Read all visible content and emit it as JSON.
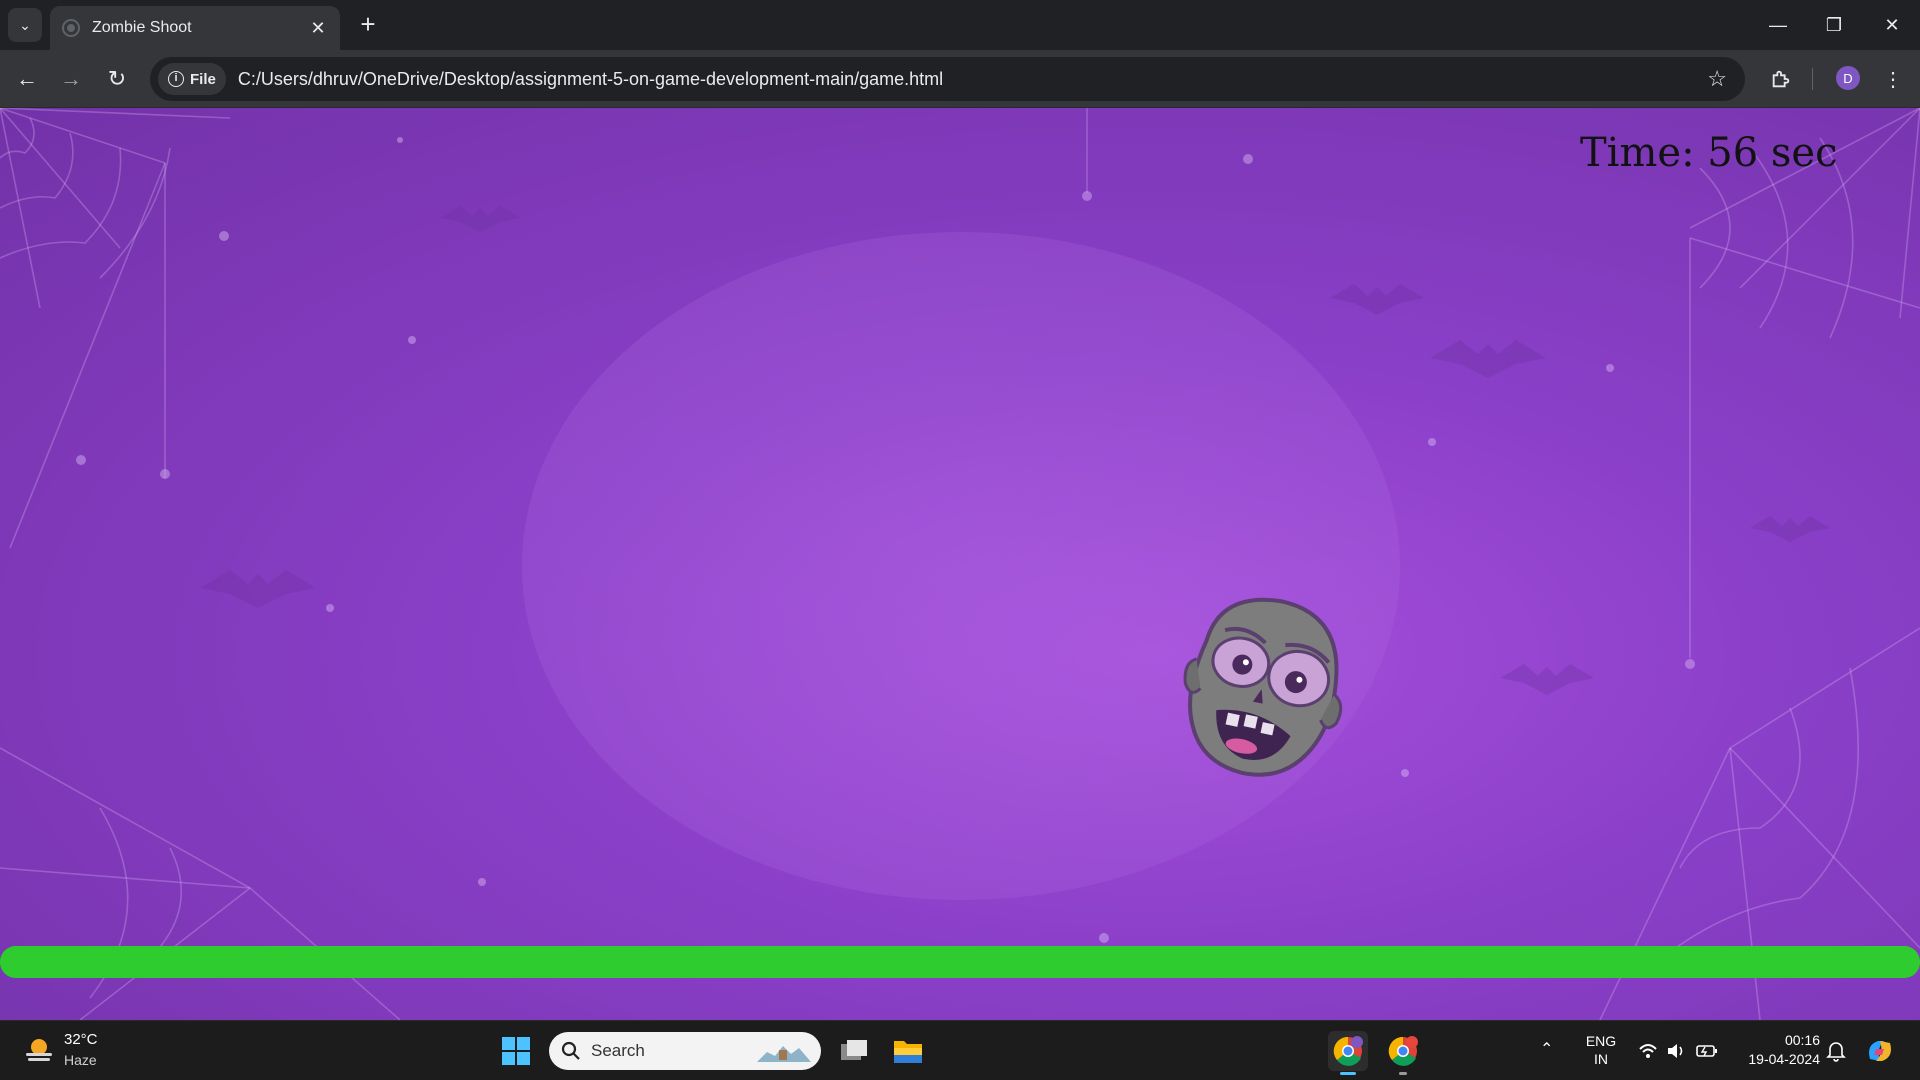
{
  "browser": {
    "tab_title": "Zombie Shoot",
    "url_chip": "File",
    "url": "C:/Users/dhruv/OneDrive/Desktop/assignment-5-on-game-development-main/game.html",
    "profile_initial": "D"
  },
  "game": {
    "timer_text": "Time: 56 sec",
    "health_fraction": 1.0,
    "colors": {
      "background": "#8a3fc8",
      "health": "#2ecc2e",
      "timer_text": "#121212"
    }
  },
  "taskbar": {
    "weather_temp": "32°C",
    "weather_condition": "Haze",
    "search_placeholder": "Search",
    "language_line1": "ENG",
    "language_line2": "IN",
    "time": "00:16",
    "date": "19-04-2024",
    "icons": [
      "weather-icon",
      "windows-start-icon",
      "search-icon",
      "task-view-icon",
      "file-explorer-icon",
      "chrome-icon",
      "chrome-icon",
      "chevron-up-icon",
      "wifi-icon",
      "volume-icon",
      "battery-icon",
      "notification-bell-icon",
      "copilot-icon"
    ]
  }
}
